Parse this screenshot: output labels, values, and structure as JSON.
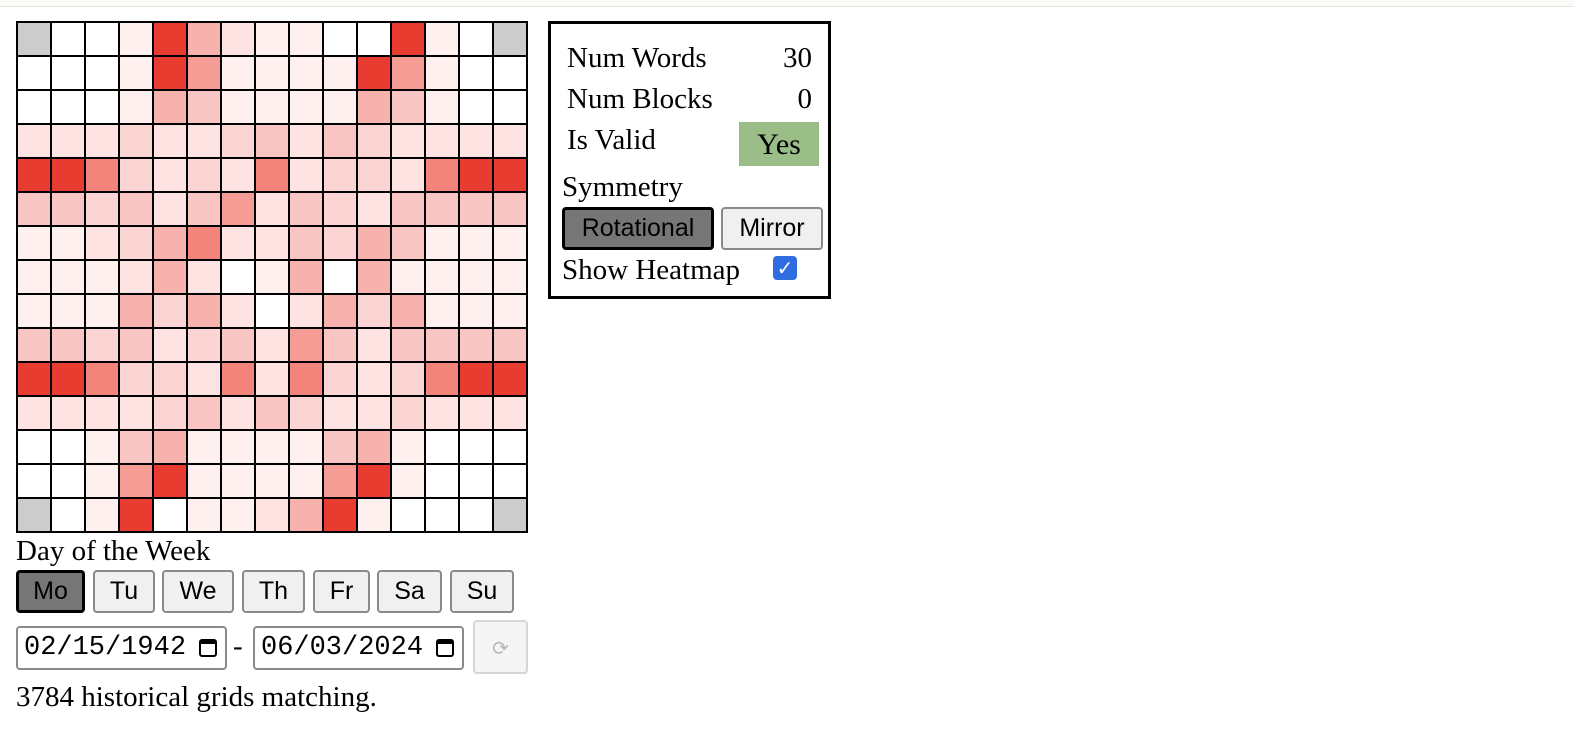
{
  "stats": {
    "num_words_label": "Num Words",
    "num_words_value": "30",
    "num_blocks_label": "Num Blocks",
    "num_blocks_value": "0",
    "is_valid_label": "Is Valid",
    "is_valid_value": "Yes",
    "symmetry_label": "Symmetry",
    "symmetry_options": [
      "Rotational",
      "Mirror"
    ],
    "symmetry_selected": "Rotational",
    "show_heatmap_label": "Show Heatmap",
    "show_heatmap_checked": true
  },
  "colors": {
    "valid_badge": "#9bbd88",
    "grid_border": "#000000",
    "selected_button": "#767676",
    "checkbox": "#2f6de1"
  },
  "heatmap": {
    "scale": [
      0,
      1,
      2,
      3,
      4,
      5,
      6,
      7,
      8,
      9,
      "G"
    ],
    "rows": [
      "G0019521100910G",
      "000196111196100",
      "000154111154100",
      "222322342432222",
      "997323272332799",
      "443424624324444",
      "112357224354111",
      "111252015051111",
      "111535202535111",
      "443423426424444",
      "997332727323799",
      "222234243223222",
      "001451111451000",
      "001691111691000",
      "G0190112591000G"
    ]
  },
  "filters": {
    "day_label": "Day of the Week",
    "days": [
      "Mo",
      "Tu",
      "We",
      "Th",
      "Fr",
      "Sa",
      "Su"
    ],
    "selected_day": "Mo",
    "date_from": "02/15/1942",
    "date_separator": "-",
    "date_to": "06/03/2024",
    "refresh_icon": "refresh-icon",
    "refresh_glyph": "⟳",
    "result_text": "3784 historical grids matching."
  }
}
